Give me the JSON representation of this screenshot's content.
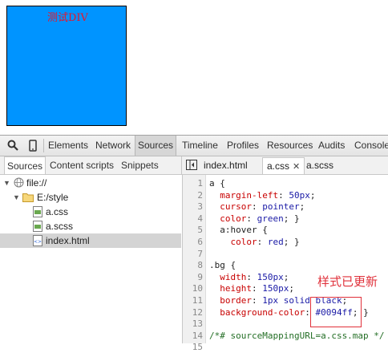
{
  "preview": {
    "div_text": "测试DIV"
  },
  "toolbar": {
    "tabs": [
      "Elements",
      "Network",
      "Sources",
      "Timeline",
      "Profiles",
      "Resources",
      "Audits",
      "Console"
    ],
    "selected_tab": "Sources"
  },
  "navigator": {
    "tabs": [
      "Sources",
      "Content scripts",
      "Snippets"
    ],
    "active_tab": "Sources",
    "tree": [
      {
        "label": "file://",
        "icon": "globe-icon",
        "indent": 0
      },
      {
        "label": "E:/style",
        "icon": "folder-icon",
        "indent": 1
      },
      {
        "label": "a.css",
        "icon": "css-file-icon",
        "indent": 2
      },
      {
        "label": "a.scss",
        "icon": "css-file-icon",
        "indent": 2
      },
      {
        "label": "index.html",
        "icon": "html-file-icon",
        "indent": 2,
        "selected": true
      }
    ]
  },
  "editor": {
    "tabs": [
      {
        "label": "index.html",
        "active": false,
        "closable": false
      },
      {
        "label": "a.css",
        "active": true,
        "closable": true,
        "close_glyph": "✕"
      },
      {
        "label": "a.scss",
        "active": false,
        "closable": false
      }
    ],
    "lines": [
      "a {",
      "  margin-left: 50px;",
      "  cursor: pointer;",
      "  color: green; }",
      "  a:hover {",
      "    color: red; }",
      "",
      ".bg {",
      "  width: 150px;",
      "  height: 150px;",
      "  border: 1px solid black;",
      "  background-color: #0094ff; }",
      "",
      "/*# sourceMappingURL=a.css.map */",
      ""
    ]
  },
  "annotation": {
    "text": "样式已更新"
  },
  "colors": {
    "demo_bg": "#0094ff",
    "annotation": "#e0303a",
    "demo_text": "#e8162a"
  }
}
